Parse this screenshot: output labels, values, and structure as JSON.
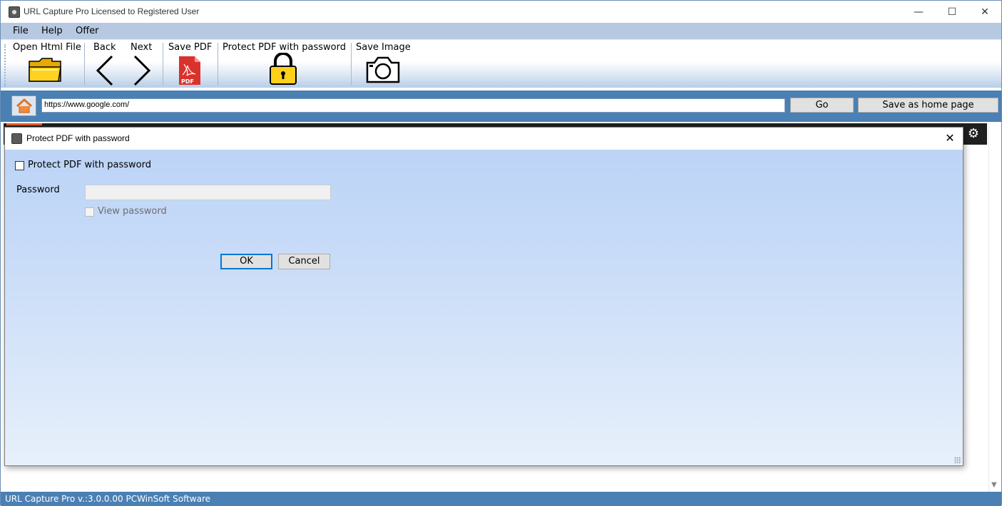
{
  "window": {
    "title": "URL Capture Pro Licensed to Registered User",
    "minimize": "—",
    "maximize": "☐",
    "close": "✕"
  },
  "menu": {
    "items": [
      "File",
      "Help",
      "Offer"
    ]
  },
  "toolbar": {
    "open_html": "Open Html File",
    "back": "Back",
    "next": "Next",
    "save_pdf": "Save PDF",
    "pdf_icon_text": "PDF",
    "protect_pdf": "Protect PDF with password",
    "save_image": "Save Image"
  },
  "address": {
    "url": "https://www.google.com/",
    "go": "Go",
    "save_home": "Save as home page"
  },
  "dialog": {
    "title": "Protect PDF with password",
    "close": "✕",
    "protect_checkbox_label": "Protect PDF with password",
    "protect_checked": false,
    "password_label": "Password",
    "password_value": "",
    "view_password_label": "View password",
    "view_password_checked": false,
    "ok": "OK",
    "cancel": "Cancel"
  },
  "status": {
    "text": "URL Capture Pro v.:3.0.0.00 PCWinSoft Software"
  },
  "icons": {
    "gear": "⚙"
  },
  "colors": {
    "accent_blue": "#4a80b4",
    "menu_bg": "#b7c9e2",
    "dialog_gradient_top": "#b9d2f6",
    "dialog_gradient_bottom": "#e7f0fb",
    "folder_yellow": "#ffd21f",
    "pdf_red": "#d9322a"
  }
}
